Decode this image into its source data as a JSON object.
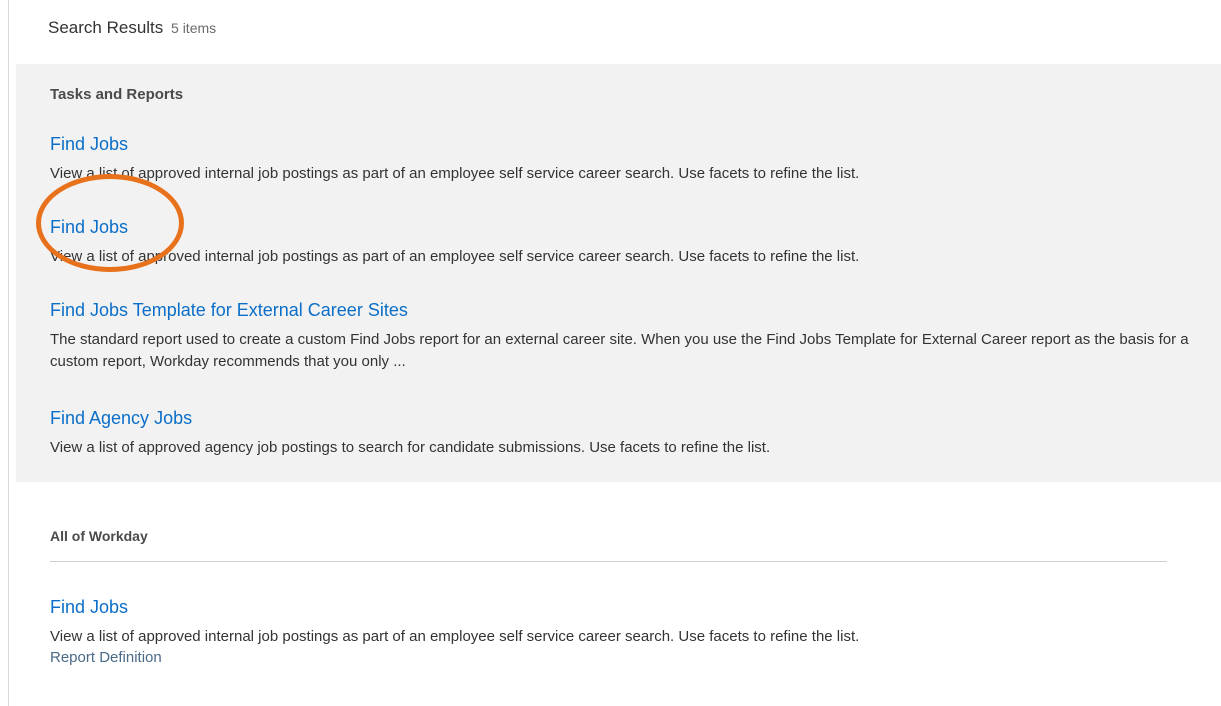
{
  "header": {
    "title": "Search Results",
    "count": "5 items"
  },
  "tasks_section": {
    "title": "Tasks and Reports",
    "items": [
      {
        "title": "Find Jobs",
        "description": "View a list of approved internal job postings as part of an employee self service career search. Use facets to refine the list."
      },
      {
        "title": "Find Jobs",
        "description": "View a list of approved internal job postings as part of an employee self service career search. Use facets to refine the list."
      },
      {
        "title": "Find Jobs Template for External Career Sites",
        "description": "The standard report used to create a custom Find Jobs report for an external career site. When you use the Find Jobs Template for External Career report as the basis for a custom report, Workday recommends that you only ..."
      },
      {
        "title": "Find Agency Jobs",
        "description": "View a list of approved agency job postings to search for candidate submissions. Use facets to refine the list."
      }
    ]
  },
  "workday_section": {
    "title": "All of Workday",
    "items": [
      {
        "title": "Find Jobs",
        "description": "View a list of approved internal job postings as part of an employee self service career search. Use facets to refine the list.",
        "subtitle": "Report Definition"
      }
    ]
  },
  "colors": {
    "link": "#0b6fc9",
    "section_background": "#f2f2f2",
    "annotation": "#e8711c"
  }
}
